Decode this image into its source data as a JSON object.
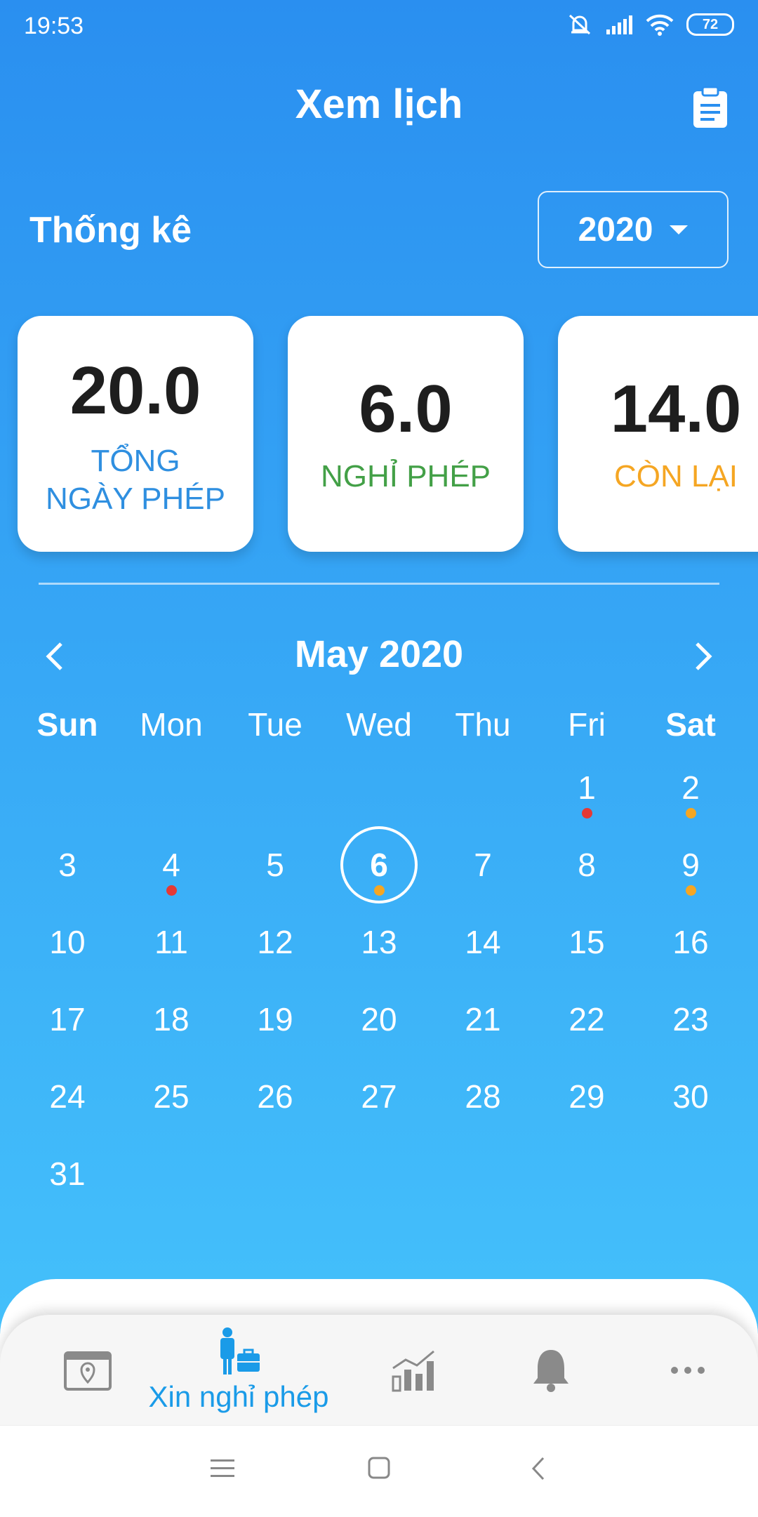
{
  "status_bar": {
    "time": "19:53",
    "battery": "72"
  },
  "header": {
    "title": "Xem lịch"
  },
  "stats": {
    "label": "Thống kê",
    "year": "2020",
    "cards": [
      {
        "value": "20.0",
        "label": "TỔNG NGÀY PHÉP",
        "color": "#2f8fe0"
      },
      {
        "value": "6.0",
        "label": "NGHỈ PHÉP",
        "color": "#43a047"
      },
      {
        "value": "14.0",
        "label": "CÒN LẠI",
        "color": "#f5a623"
      }
    ]
  },
  "calendar": {
    "month_title": "May 2020",
    "weekdays": [
      "Sun",
      "Mon",
      "Tue",
      "Wed",
      "Thu",
      "Fri",
      "Sat"
    ],
    "days": [
      "1",
      "2",
      "3",
      "4",
      "5",
      "6",
      "7",
      "8",
      "9",
      "10",
      "11",
      "12",
      "13",
      "14",
      "15",
      "16",
      "17",
      "18",
      "19",
      "20",
      "21",
      "22",
      "23",
      "24",
      "25",
      "26",
      "27",
      "28",
      "29",
      "30",
      "31"
    ],
    "selected_day": "6",
    "markers": {
      "1": "#e53935",
      "2": "#f5a623",
      "4": "#e53935",
      "6": "#f5a623",
      "9": "#f5a623"
    }
  },
  "bottom_nav": {
    "items": [
      {
        "icon": "calendar-location-icon"
      },
      {
        "icon": "leave-request-icon",
        "label": "Xin nghỉ phép",
        "active": true
      },
      {
        "icon": "statistics-chart-icon"
      },
      {
        "icon": "bell-icon"
      },
      {
        "icon": "more-icon"
      }
    ]
  },
  "colors": {
    "accent": "#1a9be8",
    "background_top": "#2a8ff0",
    "background_bottom": "#44c0fb"
  }
}
